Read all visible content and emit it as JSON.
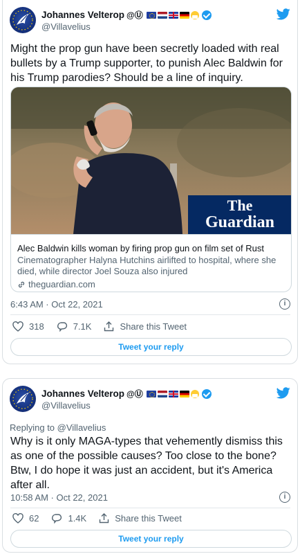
{
  "colors": {
    "accent": "#1d9bf0",
    "text": "#0f1419",
    "muted": "#536471",
    "border": "#cfd9de"
  },
  "tweets": [
    {
      "author": {
        "name": "Johannes Velterop",
        "symbols": "@Ⓤ",
        "handle": "@Villavelius"
      },
      "text": "Might the prop gun have been secretly loaded with real bullets by a Trump supporter, to punish Alec Baldwin for his Trump parodies? Should be a line of inquiry.",
      "card": {
        "title": "Alec Baldwin kills woman by firing prop gun on film set of Rust",
        "description": "Cinematographer Halyna Hutchins airlifted to hospital, where she died, while director Joel Souza also injured",
        "domain": "theguardian.com",
        "image_brand_line1": "The",
        "image_brand_line2": "Guardian"
      },
      "timestamp": "6:43 AM · Oct 22, 2021",
      "likes": "318",
      "replies": "7.1K",
      "share_label": "Share this Tweet",
      "reply_button_label": "Tweet your reply"
    },
    {
      "author": {
        "name": "Johannes Velterop",
        "symbols": "@Ⓤ",
        "handle": "@Villavelius"
      },
      "replying_to": "Replying to @Villavelius",
      "text": "Why is it only MAGA-types that vehemently dismiss this as one of the possible causes? Too close to the bone? Btw, I do hope it was just an accident, but it's America after all.",
      "timestamp": "10:58 AM · Oct 22, 2021",
      "likes": "62",
      "replies": "1.4K",
      "share_label": "Share this Tweet",
      "reply_button_label": "Tweet your reply"
    }
  ],
  "icons": {
    "twitter": "twitter-bird-icon",
    "verified": "verified-badge-icon",
    "like": "heart-icon",
    "reply": "speech-bubble-icon",
    "share": "share-icon",
    "info": "info-icon",
    "link": "link-icon"
  }
}
